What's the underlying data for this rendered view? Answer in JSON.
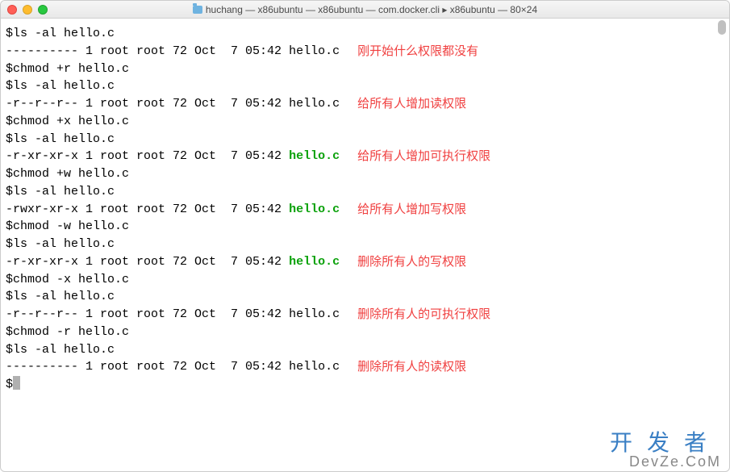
{
  "window": {
    "title": "huchang — x86ubuntu — x86ubuntu — com.docker.cli ▸ x86ubuntu — 80×24"
  },
  "lines": [
    {
      "prompt": "$",
      "cmd": "ls -al hello.c"
    },
    {
      "perm": "----------",
      "rest": " 1 root root 72 Oct  7 05:42 ",
      "file": "hello.c",
      "fileGreen": false,
      "annot": "刚开始什么权限都没有"
    },
    {
      "prompt": "$",
      "cmd": "chmod +r hello.c"
    },
    {
      "prompt": "$",
      "cmd": "ls -al hello.c"
    },
    {
      "perm": "-r--r--r--",
      "rest": " 1 root root 72 Oct  7 05:42 ",
      "file": "hello.c",
      "fileGreen": false,
      "annot": "给所有人增加读权限"
    },
    {
      "prompt": "$",
      "cmd": "chmod +x hello.c"
    },
    {
      "prompt": "$",
      "cmd": "ls -al hello.c"
    },
    {
      "perm": "-r-xr-xr-x",
      "rest": " 1 root root 72 Oct  7 05:42 ",
      "file": "hello.c",
      "fileGreen": true,
      "annot": "给所有人增加可执行权限"
    },
    {
      "prompt": "$",
      "cmd": "chmod +w hello.c"
    },
    {
      "prompt": "$",
      "cmd": "ls -al hello.c"
    },
    {
      "perm": "-rwxr-xr-x",
      "rest": " 1 root root 72 Oct  7 05:42 ",
      "file": "hello.c",
      "fileGreen": true,
      "annot": "给所有人增加写权限"
    },
    {
      "prompt": "$",
      "cmd": "chmod -w hello.c"
    },
    {
      "prompt": "$",
      "cmd": "ls -al hello.c"
    },
    {
      "perm": "-r-xr-xr-x",
      "rest": " 1 root root 72 Oct  7 05:42 ",
      "file": "hello.c",
      "fileGreen": true,
      "annot": "删除所有人的写权限"
    },
    {
      "prompt": "$",
      "cmd": "chmod -x hello.c"
    },
    {
      "prompt": "$",
      "cmd": "ls -al hello.c"
    },
    {
      "perm": "-r--r--r--",
      "rest": " 1 root root 72 Oct  7 05:42 ",
      "file": "hello.c",
      "fileGreen": false,
      "annot": "删除所有人的可执行权限"
    },
    {
      "prompt": "$",
      "cmd": "chmod -r hello.c"
    },
    {
      "prompt": "$",
      "cmd": "ls -al hello.c"
    },
    {
      "perm": "----------",
      "rest": " 1 root root 72 Oct  7 05:42 ",
      "file": "hello.c",
      "fileGreen": false,
      "annot": "删除所有人的读权限"
    },
    {
      "prompt": "$",
      "cursor": true
    }
  ],
  "watermark": {
    "cn": "开发者",
    "en": "DevZe.CoM"
  }
}
